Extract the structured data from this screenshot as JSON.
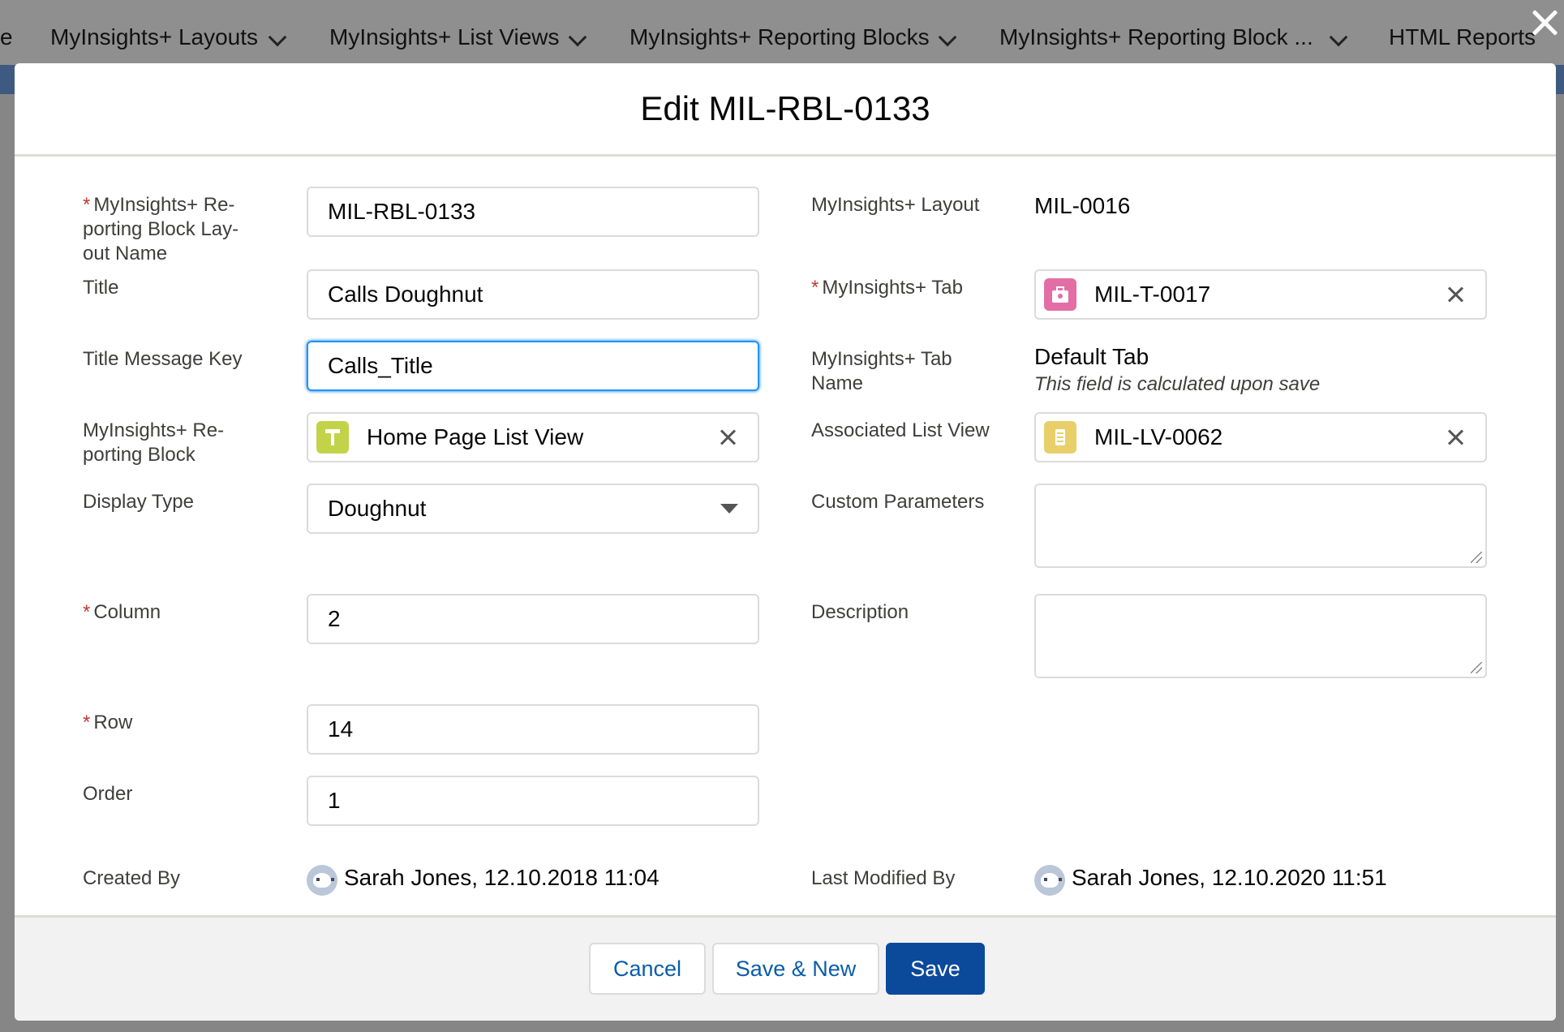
{
  "top_tabs": [
    {
      "label": "e"
    },
    {
      "label": "MyInsights+ Layouts"
    },
    {
      "label": "MyInsights+ List Views"
    },
    {
      "label": "MyInsights+ Reporting Blocks"
    },
    {
      "label": "MyInsights+ Reporting Block ..."
    },
    {
      "label": "HTML Reports"
    }
  ],
  "modal": {
    "title": "Edit MIL-RBL-0133"
  },
  "left": {
    "layout_name": {
      "label": "MyInsights+ Re-porting Block Lay-out Name",
      "value": "MIL-RBL-0133"
    },
    "title": {
      "label": "Title",
      "value": "Calls Doughnut"
    },
    "title_message_key": {
      "label": "Title Message Key",
      "value": "Calls_Title"
    },
    "reporting_block": {
      "label": "MyInsights+ Re-porting Block",
      "value": "Home Page List View",
      "icon": "reporting-block-icon"
    },
    "display_type": {
      "label": "Display Type",
      "value": "Doughnut"
    },
    "column": {
      "label": "Column",
      "value": "2"
    },
    "row": {
      "label": "Row",
      "value": "14"
    },
    "order": {
      "label": "Order",
      "value": "1"
    },
    "created_by": {
      "label": "Created By",
      "value": "Sarah Jones, 12.10.2018 11:04"
    }
  },
  "right": {
    "layout": {
      "label": "MyInsights+ Layout",
      "value": "MIL-0016"
    },
    "tab": {
      "label": "MyInsights+ Tab",
      "value": "MIL-T-0017",
      "icon": "tab-icon"
    },
    "tab_name": {
      "label": "MyInsights+ Tab Name",
      "value": "Default Tab",
      "hint": "This field is calculated upon save"
    },
    "list_view": {
      "label": "Associated List View",
      "value": "MIL-LV-0062",
      "icon": "list-view-icon"
    },
    "custom_parameters": {
      "label": "Custom Parameters",
      "value": ""
    },
    "description": {
      "label": "Description",
      "value": ""
    },
    "last_modified_by": {
      "label": "Last Modified By",
      "value": "Sarah Jones, 12.10.2020 11:51"
    }
  },
  "footer": {
    "cancel": "Cancel",
    "save_new": "Save & New",
    "save": "Save"
  },
  "colors": {
    "brand_button": "#0b4a9b",
    "required": "#c23934",
    "tab_icon_bg": "#e36ea5",
    "block_icon_bg": "#c2d34a",
    "list_icon_bg": "#e8cf6a"
  }
}
